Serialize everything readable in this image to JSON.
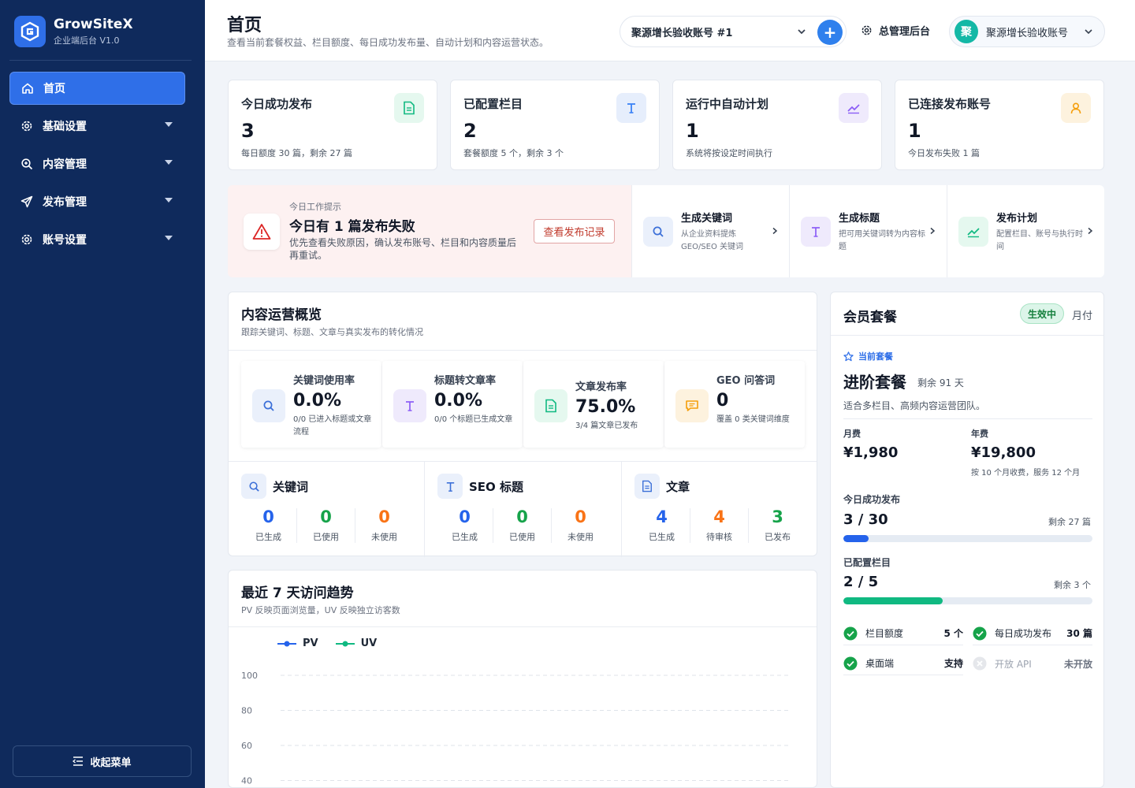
{
  "brand": {
    "name": "GrowSiteX",
    "version": "企业端后台 V1.0"
  },
  "sidebar": {
    "items": [
      {
        "label": "首页",
        "icon": "home-icon"
      },
      {
        "label": "基础设置",
        "icon": "gear-icon"
      },
      {
        "label": "内容管理",
        "icon": "zoom-icon"
      },
      {
        "label": "发布管理",
        "icon": "send-icon"
      },
      {
        "label": "账号设置",
        "icon": "gear-icon"
      }
    ],
    "collapse_label": "收起菜单"
  },
  "header": {
    "title": "首页",
    "subtitle": "查看当前套餐权益、栏目额度、每日成功发布量、自动计划和内容运营状态。",
    "account_select": "聚源增长验收账号 #1",
    "add_label": "+",
    "admin_label": "总管理后台",
    "user_avatar": "聚",
    "user_name": "聚源增长验收账号"
  },
  "stats": [
    {
      "title": "今日成功发布",
      "value": "3",
      "sub": "每日额度 30 篇，剩余 27 篇",
      "icon": "document-icon",
      "color": "#10b981"
    },
    {
      "title": "已配置栏目",
      "value": "2",
      "sub": "套餐额度 5 个，剩余 3 个",
      "icon": "text-icon",
      "color": "#3b82f6"
    },
    {
      "title": "运行中自动计划",
      "value": "1",
      "sub": "系统将按设定时间执行",
      "icon": "trend-icon",
      "color": "#8b5cf6"
    },
    {
      "title": "已连接发布账号",
      "value": "1",
      "sub": "今日发布失败 1 篇",
      "icon": "user-icon",
      "color": "#f59e0b"
    }
  ],
  "alert": {
    "hint": "今日工作提示",
    "title": "今日有 1 篇发布失败",
    "desc": "优先查看失败原因，确认发布账号、栏目和内容质量后再重试。",
    "button": "查看发布记录"
  },
  "quick": [
    {
      "title": "生成关键词",
      "desc": "从企业资料提炼 GEO/SEO 关键词"
    },
    {
      "title": "生成标题",
      "desc": "把可用关键词转为内容标题"
    },
    {
      "title": "发布计划",
      "desc": "配置栏目、账号与执行时间"
    }
  ],
  "overview": {
    "title": "内容运营概览",
    "subtitle": "跟踪关键词、标题、文章与真实发布的转化情况",
    "metrics": [
      {
        "label": "关键词使用率",
        "value": "0.0%",
        "desc": "0/0 已进入标题或文章流程"
      },
      {
        "label": "标题转文章率",
        "value": "0.0%",
        "desc": "0/0 个标题已生成文章"
      },
      {
        "label": "文章发布率",
        "value": "75.0%",
        "desc": "3/4 篇文章已发布"
      },
      {
        "label": "GEO 问答词",
        "value": "0",
        "desc": "覆盖 0 类关键词维度"
      }
    ],
    "groups": [
      {
        "title": "关键词",
        "items": [
          {
            "num": "0",
            "label": "已生成"
          },
          {
            "num": "0",
            "label": "已使用"
          },
          {
            "num": "0",
            "label": "未使用"
          }
        ]
      },
      {
        "title": "SEO 标题",
        "items": [
          {
            "num": "0",
            "label": "已生成"
          },
          {
            "num": "0",
            "label": "已使用"
          },
          {
            "num": "0",
            "label": "未使用"
          }
        ]
      },
      {
        "title": "文章",
        "items": [
          {
            "num": "4",
            "label": "已生成"
          },
          {
            "num": "4",
            "label": "待审核"
          },
          {
            "num": "3",
            "label": "已发布"
          }
        ]
      }
    ]
  },
  "trend": {
    "title": "最近 7 天访问趋势",
    "subtitle": "PV 反映页面浏览量，UV 反映独立访客数",
    "legend": [
      "PV",
      "UV"
    ],
    "y_ticks": [
      "100",
      "80",
      "60",
      "40"
    ]
  },
  "chart_data": {
    "type": "line",
    "title": "最近 7 天访问趋势",
    "xlabel": "",
    "ylabel": "",
    "y_ticks": [
      100,
      80,
      60,
      40
    ],
    "grid": true,
    "legend_position": "top-left",
    "series": [
      {
        "name": "PV",
        "color": "#2563eb",
        "values": []
      },
      {
        "name": "UV",
        "color": "#10b981",
        "values": []
      }
    ]
  },
  "plan": {
    "title": "会员套餐",
    "status": "生效中",
    "cycle": "月付",
    "current_label": "当前套餐",
    "name": "进阶套餐",
    "remaining": "剩余 91 天",
    "desc": "适合多栏目、高频内容运营团队。",
    "monthly_label": "月费",
    "monthly_price": "¥1,980",
    "yearly_label": "年费",
    "yearly_price": "¥19,800",
    "yearly_note": "按 10 个月收费，服务 12 个月",
    "publish_label": "今日成功发布",
    "publish_value": "3 / 30",
    "publish_left": "剩余 27 篇",
    "publish_ratio": 0.1,
    "column_label": "已配置栏目",
    "column_value": "2 / 5",
    "column_left": "剩余 3 个",
    "column_ratio": 0.4,
    "features": [
      {
        "label": "栏目额度",
        "value": "5 个",
        "enabled": true
      },
      {
        "label": "每日成功发布",
        "value": "30 篇",
        "enabled": true
      },
      {
        "label": "桌面端",
        "value": "支持",
        "enabled": true
      },
      {
        "label": "开放 API",
        "value": "未开放",
        "enabled": false
      }
    ]
  },
  "colors": {
    "primary": "#2f6fe8",
    "sidebar": "#0f2a5c",
    "success": "#10b981",
    "warning": "#f59e0b",
    "danger": "#dc2626",
    "blue_num": "#2563eb",
    "green_num": "#16a34a",
    "orange_num": "#f97316"
  }
}
